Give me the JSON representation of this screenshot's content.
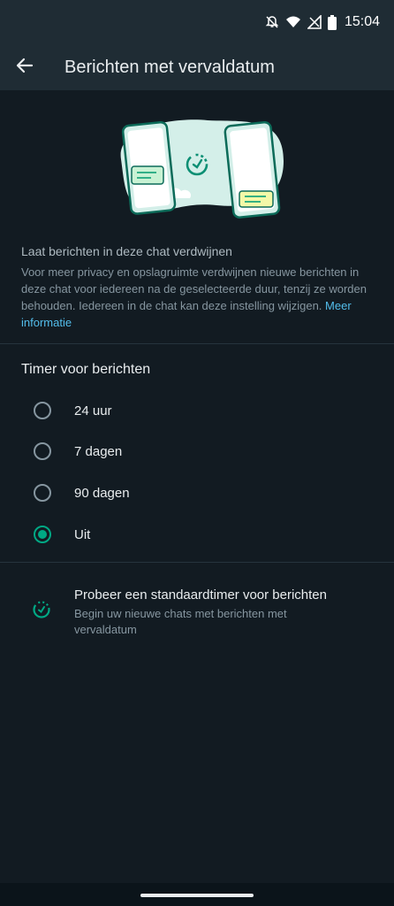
{
  "status_bar": {
    "time": "15:04",
    "icons": [
      "notifications-off-icon",
      "wifi-icon",
      "signal-icon",
      "battery-icon"
    ]
  },
  "app_bar": {
    "title": "Berichten met vervaldatum",
    "back_icon": "arrow-left-icon"
  },
  "intro": {
    "title": "Laat berichten in deze chat verdwijnen",
    "body": "Voor meer privacy en opslagruimte verdwijnen nieuwe berichten in deze chat voor iedereen na de geselecteerde duur, tenzij ze worden behouden. Iedereen in de chat kan deze instelling wijzigen.",
    "link": "Meer informatie"
  },
  "timer": {
    "title": "Timer voor berichten",
    "options": [
      {
        "label": "24 uur",
        "selected": false
      },
      {
        "label": "7 dagen",
        "selected": false
      },
      {
        "label": "90 dagen",
        "selected": false
      },
      {
        "label": "Uit",
        "selected": true
      }
    ]
  },
  "default_timer": {
    "title": "Probeer een standaardtimer voor berichten",
    "subtitle": "Begin uw nieuwe chats met berichten met vervaldatum",
    "icon": "timer-icon"
  },
  "colors": {
    "background": "#121b22",
    "app_bar": "#1f2c34",
    "accent": "#00a884",
    "link": "#53bdeb"
  }
}
